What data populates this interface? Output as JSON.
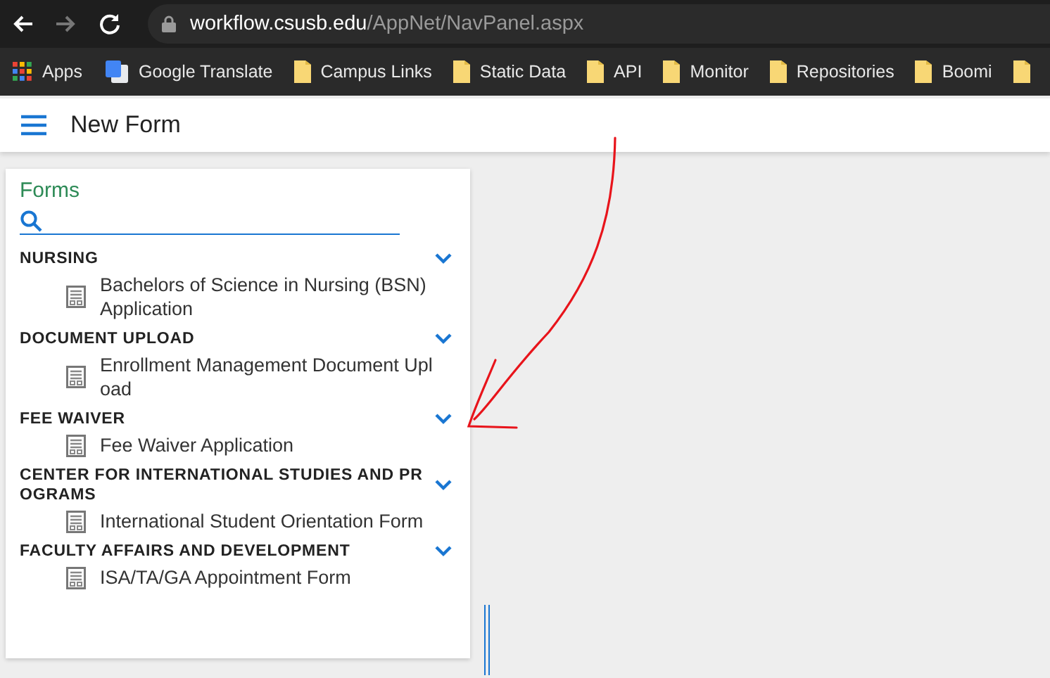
{
  "browser": {
    "url_host": "workflow.csusb.edu",
    "url_path": "/AppNet/NavPanel.aspx",
    "bookmarks": [
      {
        "kind": "apps",
        "label": "Apps"
      },
      {
        "kind": "translate",
        "label": "Google Translate"
      },
      {
        "kind": "folder",
        "label": "Campus Links"
      },
      {
        "kind": "folder",
        "label": "Static Data"
      },
      {
        "kind": "folder",
        "label": "API"
      },
      {
        "kind": "folder",
        "label": "Monitor"
      },
      {
        "kind": "folder",
        "label": "Repositories"
      },
      {
        "kind": "folder",
        "label": "Boomi"
      },
      {
        "kind": "folder"
      }
    ]
  },
  "header": {
    "title": "New Form"
  },
  "panel": {
    "title": "Forms",
    "groups": [
      {
        "title": "NURSING",
        "expanded": true,
        "forms": [
          "Bachelors of Science in Nursing (BSN) Application"
        ]
      },
      {
        "title": "DOCUMENT UPLOAD",
        "expanded": true,
        "forms": [
          "Enrollment Management Document Upload"
        ]
      },
      {
        "title": "FEE WAIVER",
        "expanded": true,
        "forms": [
          "Fee Waiver Application"
        ]
      },
      {
        "title": "CENTER FOR INTERNATIONAL STUDIES AND PROGRAMS",
        "expanded": true,
        "forms": [
          "International Student Orientation Form"
        ]
      },
      {
        "title": "FACULTY AFFAIRS AND DEVELOPMENT",
        "expanded": true,
        "forms": [
          "ISA/TA/GA Appointment Form"
        ]
      }
    ]
  }
}
